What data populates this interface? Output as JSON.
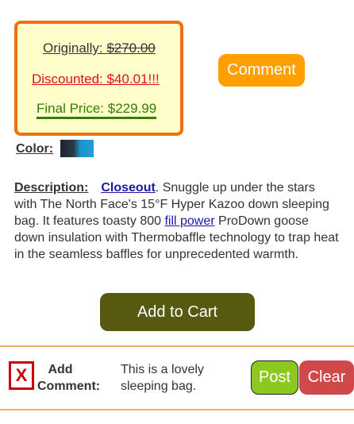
{
  "pricing": {
    "original_label": "Originally: ",
    "original_amount": "$270.00",
    "discounted": "Discounted: $40.01!!!",
    "final": "Final Price: $229.99"
  },
  "comment_button": "Comment",
  "color": {
    "label": "Color:",
    "swatch_colors": [
      "#1b2330",
      "#1fa0d8"
    ]
  },
  "description": {
    "label": "Description:",
    "closeout_link": "Closeout",
    "text_part1": ". Snuggle up under the stars with The North Face's 15°F Hyper Kazoo down sleeping bag. It features toasty 800 ",
    "fill_power_link": "fill power",
    "text_part2": " ProDown goose down insulation with Thermobaffle technology to trap heat in the seamless baffles for unprecedented warmth."
  },
  "add_to_cart": "Add to Cart",
  "comment_section": {
    "close_icon": "X",
    "label": "Add Comment:",
    "text": "This is a lovely sleeping bag.",
    "post_button": "Post",
    "clear_button": "Clear"
  },
  "colors": {
    "price_border": "#f07010",
    "price_bg": "#ffffcc",
    "discount_red": "#e01010",
    "final_green": "#338000",
    "comment_orange": "#ffa000",
    "cart_olive": "#555a10",
    "post_green": "#8cc820",
    "clear_red": "#d04848",
    "divider": "#f0b070"
  }
}
